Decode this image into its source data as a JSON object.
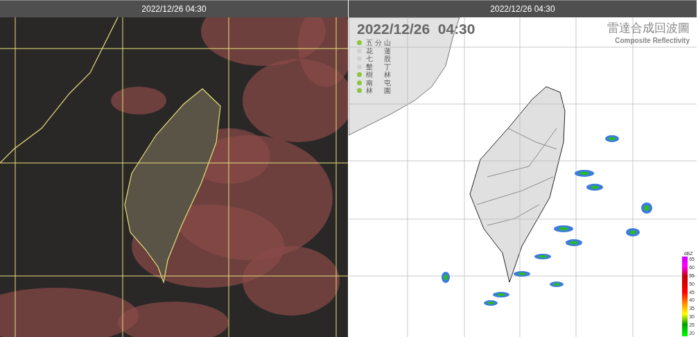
{
  "panels": [
    {
      "kind": "satellite",
      "header": "2022/12/26 04:30"
    },
    {
      "kind": "radar",
      "header": "2022/12/26 04:30",
      "title": "2022/12/26  04:30",
      "product": "雷達合成回波圖",
      "product_en": "Composite Reflectivity",
      "stations": [
        {
          "name": "五分山",
          "on": true
        },
        {
          "name": "花蓮",
          "on": false
        },
        {
          "name": "七股",
          "on": false
        },
        {
          "name": "墾丁",
          "on": false
        },
        {
          "name": "樹林",
          "on": true
        },
        {
          "name": "南屯",
          "on": true
        },
        {
          "name": "林園",
          "on": true
        }
      ],
      "scale_unit": "dBZ",
      "scale_labels": [
        "65",
        "60",
        "55",
        "50",
        "45",
        "40",
        "35",
        "30",
        "25",
        "20"
      ]
    }
  ]
}
